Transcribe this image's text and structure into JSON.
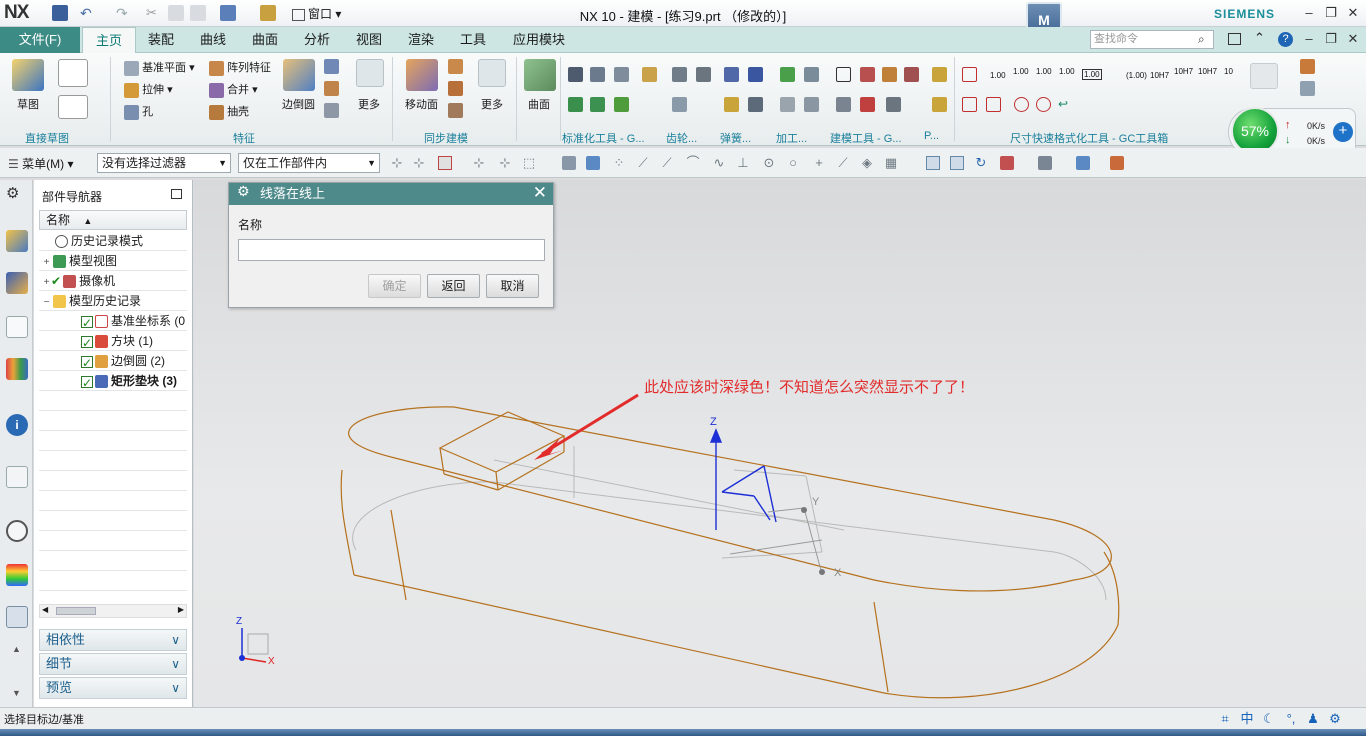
{
  "titlebar": {
    "logo": "NX",
    "window_menu": "窗口",
    "title": "NX 10 - 建模 - [练习9.prt （修改的）]",
    "brand": "SIEMENS"
  },
  "tabs": {
    "file": "文件(F)",
    "items": [
      "主页",
      "装配",
      "曲线",
      "曲面",
      "分析",
      "视图",
      "渲染",
      "工具",
      "应用模块"
    ],
    "search_placeholder": "查找命令"
  },
  "ribbon": {
    "sketch": "草图",
    "datum_plane": "基准平面",
    "extrude": "拉伸",
    "hole": "孔",
    "pattern_feature": "阵列特征",
    "unite": "合并",
    "shell": "抽壳",
    "edge_blend": "边倒圆",
    "more": "更多",
    "move_face": "移动面",
    "surface": "曲面",
    "group_labels": {
      "direct_sketch": "直接草图",
      "feature": "特征",
      "sync_modeling": "同步建模",
      "std_tools": "标准化工具 - G...",
      "gear": "齿轮...",
      "spring": "弹簧...",
      "machining": "加工...",
      "modeling_tools": "建模工具 - G...",
      "p": "P...",
      "dim_tools": "尺寸快速格式化工具 - GC工具箱"
    },
    "dim_values": [
      "1.00",
      "1.00",
      "1.00",
      "1.00",
      "1.00",
      "(1.00)",
      "10H7",
      "10H7",
      "10H7",
      "10"
    ]
  },
  "network": {
    "percent": "57%",
    "upload": "0K/s",
    "download": "0K/s"
  },
  "selection_bar": {
    "menu": "菜单(M)",
    "filter": "没有选择过滤器",
    "scope": "仅在工作部件内"
  },
  "navigator": {
    "title": "部件导航器",
    "column": "名称",
    "rows": [
      {
        "label": "历史记录模式"
      },
      {
        "label": "模型视图"
      },
      {
        "label": "摄像机"
      },
      {
        "label": "模型历史记录"
      },
      {
        "label": "基准坐标系 (0"
      },
      {
        "label": "方块 (1)"
      },
      {
        "label": "边倒圆 (2)"
      },
      {
        "label": "矩形垫块 (3)"
      }
    ],
    "sections": [
      "相依性",
      "细节",
      "预览"
    ]
  },
  "dialog": {
    "title": "线落在线上",
    "label": "名称",
    "value": "",
    "ok": "确定",
    "back": "返回",
    "cancel": "取消"
  },
  "viewport": {
    "annotation": "此处应该时深绿色！不知道怎么突然显示不了了！",
    "axis_z": "Z",
    "axis_y": "Y",
    "axis_x": "X",
    "triad_z": "Z",
    "triad_x": "X"
  },
  "status": {
    "text": "选择目标边/基准",
    "ime": [
      "中",
      "☾",
      "°,",
      "♟",
      "⚙"
    ]
  },
  "colors": {
    "accent": "#3d8b85",
    "edges": "#b5711e",
    "annotation": "#e22c2c",
    "csys": "#1d2fd6"
  }
}
